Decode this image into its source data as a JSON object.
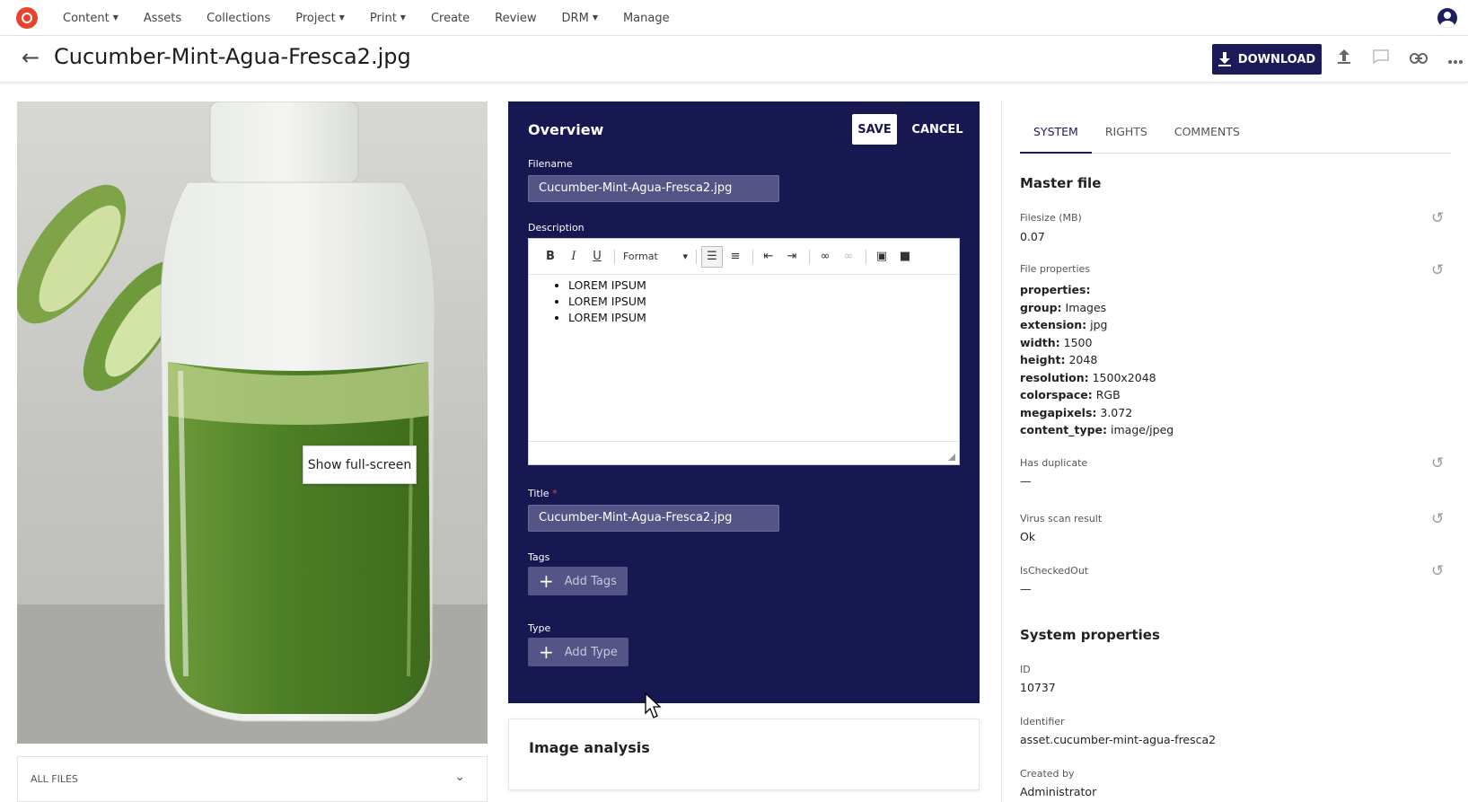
{
  "nav": {
    "items": [
      {
        "label": "Content",
        "dropdown": true
      },
      {
        "label": "Assets",
        "dropdown": false
      },
      {
        "label": "Collections",
        "dropdown": false
      },
      {
        "label": "Project",
        "dropdown": true
      },
      {
        "label": "Print",
        "dropdown": true
      },
      {
        "label": "Create",
        "dropdown": false
      },
      {
        "label": "Review",
        "dropdown": false
      },
      {
        "label": "DRM",
        "dropdown": true
      },
      {
        "label": "Manage",
        "dropdown": false
      }
    ]
  },
  "header": {
    "title": "Cucumber-Mint-Agua-Fresca2.jpg",
    "download_label": "DOWNLOAD"
  },
  "preview": {
    "tooltip": "Show full-screen",
    "all_files_label": "ALL FILES"
  },
  "overview": {
    "title": "Overview",
    "save_label": "SAVE",
    "cancel_label": "CANCEL",
    "filename_label": "Filename",
    "filename_value": "Cucumber-Mint-Agua-Fresca2.jpg",
    "description_label": "Description",
    "format_label": "Format",
    "description_items": [
      "LOREM IPSUM",
      "LOREM IPSUM",
      "LOREM IPSUM"
    ],
    "title_label": "Title",
    "title_required": "*",
    "title_value": "Cucumber-Mint-Agua-Fresca2.jpg",
    "tags_label": "Tags",
    "add_tags_label": "Add Tags",
    "type_label": "Type",
    "add_type_label": "Add Type"
  },
  "image_analysis": {
    "title": "Image analysis"
  },
  "side": {
    "tabs": [
      "SYSTEM",
      "RIGHTS",
      "COMMENTS"
    ],
    "master_file_title": "Master file",
    "filesize_label": "Filesize (MB)",
    "filesize_value": "0.07",
    "file_props_label": "File properties",
    "file_props": [
      {
        "key": "properties:",
        "value": ""
      },
      {
        "key": "group:",
        "value": "Images"
      },
      {
        "key": "extension:",
        "value": "jpg"
      },
      {
        "key": "width:",
        "value": "1500"
      },
      {
        "key": "height:",
        "value": "2048"
      },
      {
        "key": "resolution:",
        "value": "1500x2048"
      },
      {
        "key": "colorspace:",
        "value": "RGB"
      },
      {
        "key": "megapixels:",
        "value": "3.072"
      },
      {
        "key": "content_type:",
        "value": "image/jpeg"
      }
    ],
    "has_duplicate_label": "Has duplicate",
    "has_duplicate_value": "—",
    "virus_label": "Virus scan result",
    "virus_value": "Ok",
    "checked_out_label": "IsCheckedOut",
    "checked_out_value": "—",
    "system_props_title": "System properties",
    "id_label": "ID",
    "id_value": "10737",
    "identifier_label": "Identifier",
    "identifier_value": "asset.cucumber-mint-agua-fresca2",
    "created_by_label": "Created by",
    "created_by_value": "Administrator"
  },
  "colors": {
    "navy": "#171752",
    "brand_red": "#e8432d",
    "field_bg": "#545487"
  }
}
